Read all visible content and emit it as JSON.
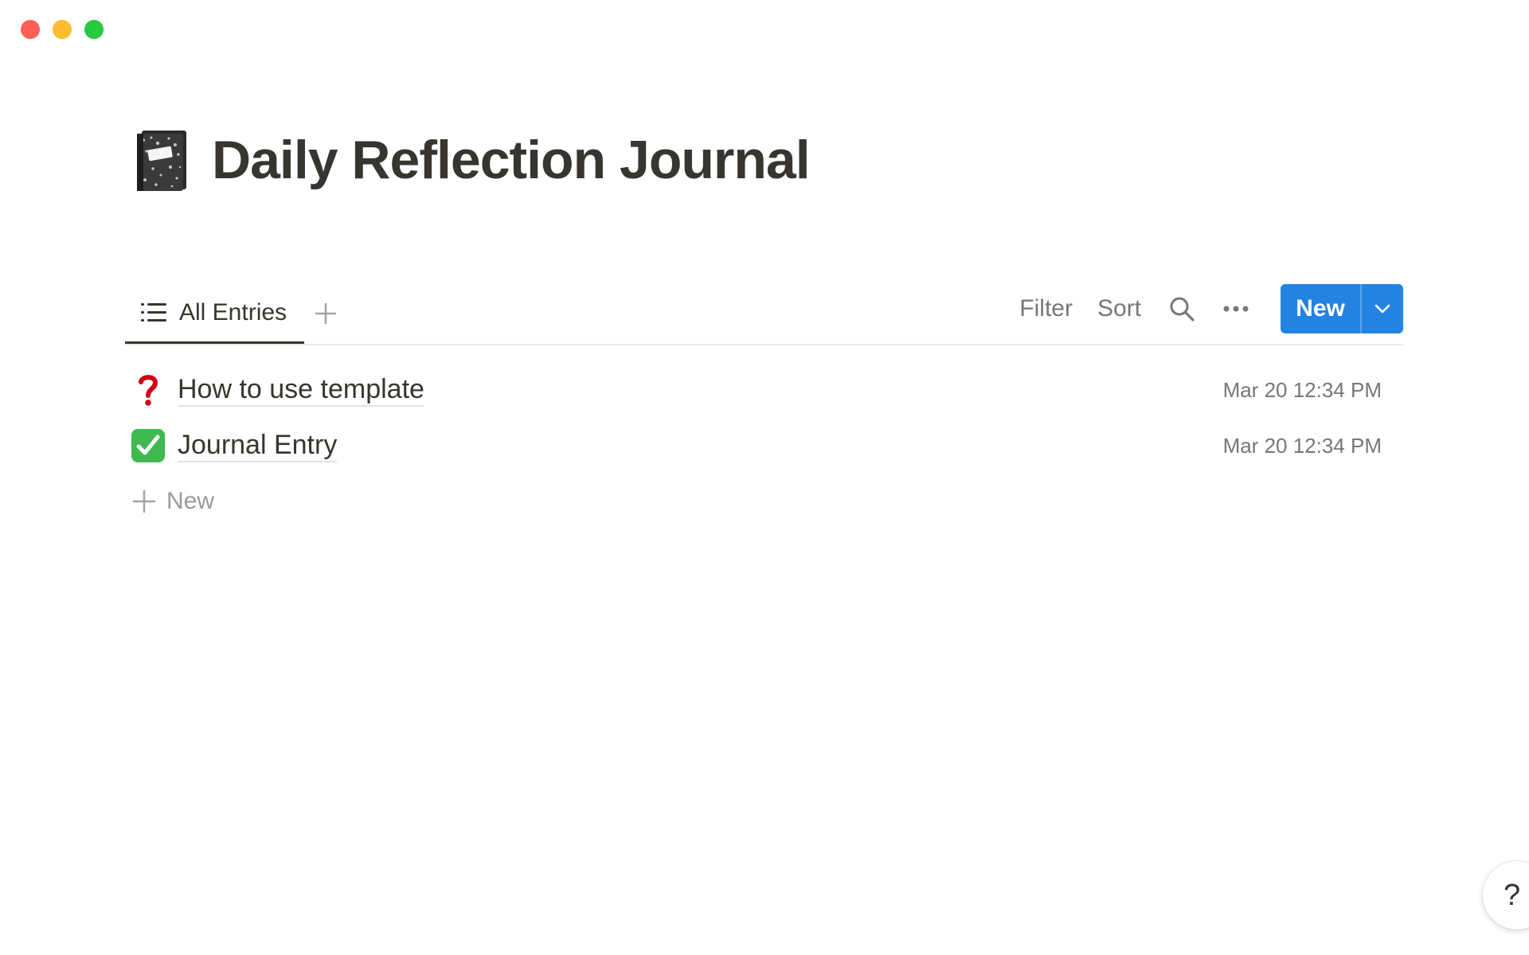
{
  "window": {
    "controls": [
      "close",
      "minimize",
      "zoom"
    ]
  },
  "page": {
    "icon": "composition-notebook-icon",
    "title": "Daily Reflection Journal"
  },
  "views": {
    "tabs": [
      {
        "label": "All Entries",
        "icon": "list-icon",
        "active": true
      }
    ],
    "add_view_icon": "plus-icon"
  },
  "toolbar": {
    "filter_label": "Filter",
    "sort_label": "Sort",
    "search_icon": "search-icon",
    "more_icon": "more-icon",
    "new_label": "New",
    "new_caret_icon": "chevron-down-icon"
  },
  "entries": [
    {
      "icon": "question-mark-icon",
      "title": "How to use template",
      "date": "Mar 20 12:34 PM"
    },
    {
      "icon": "check-mark-icon",
      "title": "Journal Entry",
      "date": "Mar 20 12:34 PM"
    }
  ],
  "new_row": {
    "label": "New",
    "icon": "plus-icon"
  },
  "help": {
    "label": "?"
  },
  "colors": {
    "accent": "#2383e2",
    "text": "#37352f",
    "muted": "#787774",
    "check_green": "#3fb950",
    "question_red": "#d0021b"
  }
}
